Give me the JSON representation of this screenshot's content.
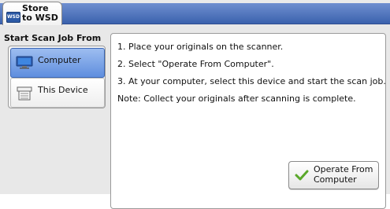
{
  "tab": {
    "title": "Store to WSD",
    "icon": "wsd-icon"
  },
  "left": {
    "heading": "Start Scan Job From",
    "options": [
      {
        "label": "Computer",
        "icon": "monitor-icon",
        "selected": true
      },
      {
        "label": "This Device",
        "icon": "device-icon",
        "selected": false
      }
    ]
  },
  "instructions": [
    "1. Place your originals on the scanner.",
    "2. Select \"Operate From Computer\".",
    "3. At your computer, select this device and start the scan job.",
    "Note: Collect your originals after scanning is complete."
  ],
  "action": {
    "label": "Operate From Computer",
    "icon": "check-icon"
  },
  "colors": {
    "header_blue": "#3b62ad",
    "selected_blue": "#5f8ede",
    "check_green": "#5aa82a"
  }
}
